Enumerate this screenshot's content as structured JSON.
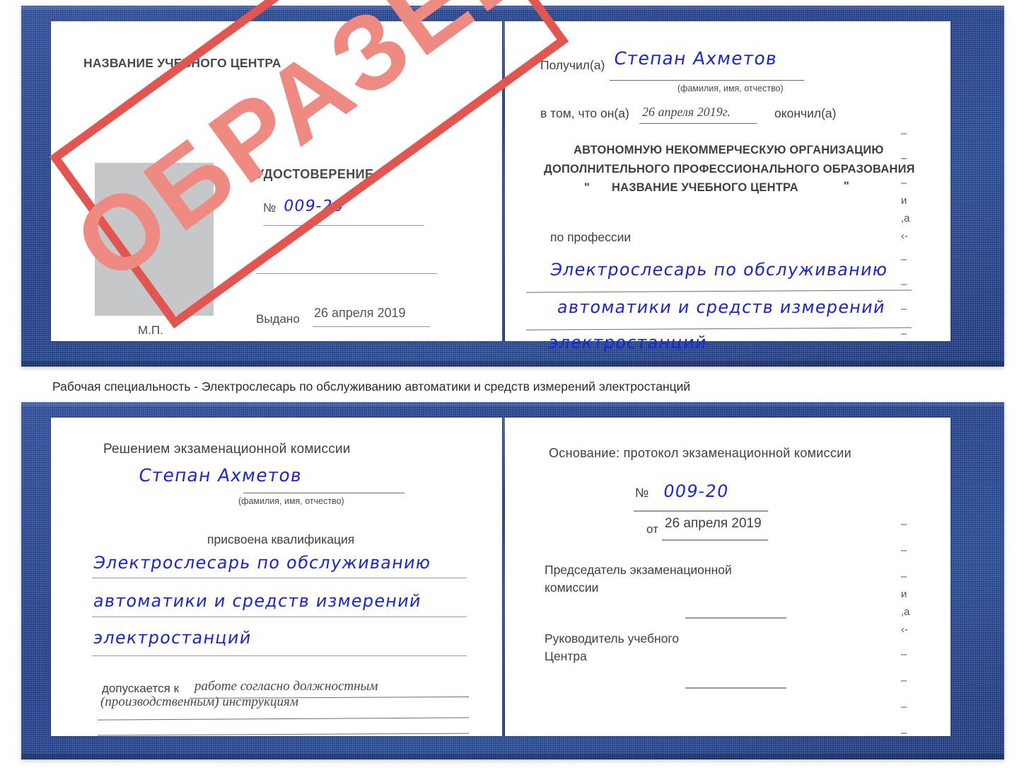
{
  "document": {
    "type": "certificate-book",
    "colors": {
      "cover_blue": "#1d3b84",
      "stamp_red": "#e2564f",
      "stamp_fill": "#ef8a83",
      "handwriting_blue": "#1a26d8",
      "photo_placeholder_gray": "#c6c7c8"
    }
  },
  "stamp": {
    "label": "ОБРАЗЕЦ"
  },
  "cert_top": {
    "left_page": {
      "org_title": "НАЗВАНИЕ УЧЕБНОГО ЦЕНТРА",
      "doc_title": "УДОСТОВЕРЕНИЕ",
      "number_symbol": "№",
      "number_value": "009-20",
      "issued_label": "Выдано",
      "issued_value": "26 апреля 2019",
      "seal_label": "М.П."
    },
    "right_page": {
      "received_label": "Получил(а)",
      "received_value": "Степан Ахметов",
      "fio_hint": "(фамилия, имя, отчество)",
      "in_that_label": "в том, что он(а)",
      "in_that_date": "26 апреля 2019г.",
      "finished_label": "окончил(а)",
      "org_line1": "АВТОНОМНУЮ НЕКОММЕРЧЕСКУЮ ОРГАНИЗАЦИЮ",
      "org_line2": "ДОПОЛНИТЕЛЬНОГО ПРОФЕССИОНАЛЬНОГО ОБРАЗОВАНИЯ",
      "org_quote_open": "\"",
      "org_line3": "НАЗВАНИЕ УЧЕБНОГО ЦЕНТРА",
      "org_quote_close": "\"",
      "profession_label": "по профессии",
      "profession_line1": "Электрослесарь по обслуживанию",
      "profession_line2": "автоматики и средств измерений",
      "profession_line3": "электростанций",
      "edge_fragments": [
        "–",
        "–",
        "–",
        "и",
        ",а",
        "‹-",
        "–",
        "–",
        "–",
        "–"
      ]
    }
  },
  "caption": {
    "text": "Рабочая специальность - Электрослесарь по обслуживанию автоматики и средств измерений электростанций"
  },
  "cert_bottom": {
    "left_page": {
      "decision_title": "Решением экзаменационной комиссии",
      "name_value": "Степан Ахметов",
      "fio_hint": "(фамилия, имя, отчество)",
      "qualification_label": "присвоена квалификация",
      "qualification_line1": "Электрослесарь по обслуживанию",
      "qualification_line2": "автоматики и средств измерений",
      "qualification_line3": "электростанций",
      "admitted_label": "допускается к",
      "admitted_value1": "работе согласно должностным",
      "admitted_value2": "(производственным) инструкциям"
    },
    "right_page": {
      "basis_label": "Основание: протокол экзаменационной комиссии",
      "number_symbol": "№",
      "number_value": "009-20",
      "from_label": "от",
      "from_value": "26 апреля 2019",
      "chairman_line1": "Председатель экзаменационной",
      "chairman_line2": "комиссии",
      "head_line1": "Руководитель учебного",
      "head_line2": "Центра",
      "edge_fragments": [
        "–",
        "–",
        "–",
        "и",
        ",а",
        "‹-",
        "–",
        "–",
        "–",
        "–"
      ]
    }
  }
}
